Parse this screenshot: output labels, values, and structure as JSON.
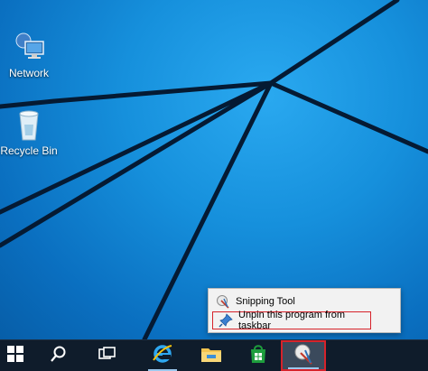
{
  "desktop": {
    "icons": [
      {
        "label": "Network",
        "icon": "network-icon"
      },
      {
        "label": "Recycle Bin",
        "icon": "recycle-bin-icon"
      }
    ],
    "background_color": "#1690dc"
  },
  "taskbar": {
    "background_color": "#0f1c2b",
    "buttons": [
      {
        "name": "start",
        "icon": "windows-logo-icon"
      },
      {
        "name": "search",
        "icon": "search-icon"
      },
      {
        "name": "task-view",
        "icon": "task-view-icon"
      },
      {
        "name": "internet-explorer",
        "icon": "internet-explorer-icon"
      },
      {
        "name": "file-explorer",
        "icon": "folder-icon"
      },
      {
        "name": "store",
        "icon": "store-icon"
      },
      {
        "name": "snipping-tool",
        "icon": "snipping-tool-icon"
      }
    ],
    "highlight_color": "#d6232b"
  },
  "jumplist": {
    "app_title": "Snipping Tool",
    "unpin_label": "Unpin this program from taskbar"
  }
}
